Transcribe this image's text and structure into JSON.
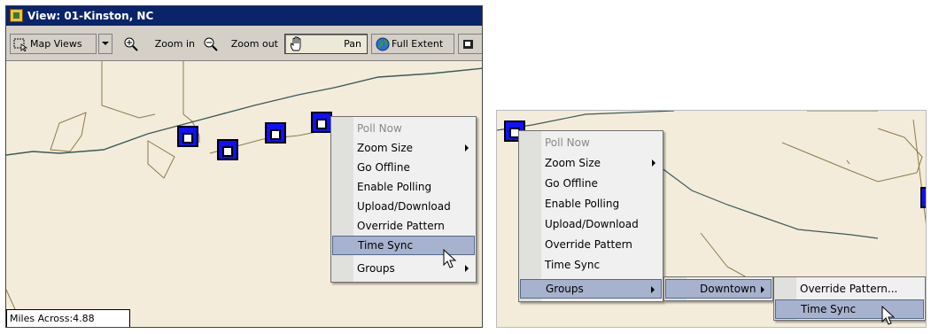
{
  "left_window": {
    "title": "View: 01-Kinston, NC",
    "toolbar": {
      "map_views": "Map Views",
      "zoom_in": "Zoom in",
      "zoom_out": "Zoom out",
      "pan": "Pan",
      "full_extent": "Full Extent"
    },
    "scale_text": "Miles Across:4.88",
    "context_menu": [
      {
        "label": "Poll Now"
      },
      {
        "label": "Zoom Size"
      },
      {
        "label": "Go Offline"
      },
      {
        "label": "Enable Polling"
      },
      {
        "label": "Upload/Download"
      },
      {
        "label": "Override Pattern"
      },
      {
        "label": "Time Sync"
      },
      {
        "label": "Groups"
      }
    ]
  },
  "right_panel": {
    "context_menu": [
      {
        "label": "Poll Now"
      },
      {
        "label": "Zoom Size"
      },
      {
        "label": "Go Offline"
      },
      {
        "label": "Enable Polling"
      },
      {
        "label": "Upload/Download"
      },
      {
        "label": "Override Pattern"
      },
      {
        "label": "Time Sync"
      },
      {
        "label": "Groups"
      }
    ],
    "groups_submenu": [
      {
        "label": "Downtown"
      }
    ],
    "downtown_submenu": [
      {
        "label": "Override Pattern..."
      },
      {
        "label": "Time Sync"
      }
    ]
  },
  "colors": {
    "titlebar": "#0a246a",
    "menu_highlight": "#a7b2cf",
    "map_background": "#f4ecda",
    "device_icon": "#1010ff"
  },
  "icons": [
    "map-views-icon",
    "zoom-in-icon",
    "zoom-out-icon",
    "pan-hand-icon",
    "globe-icon",
    "signal-device-icon",
    "arrow-cursor-icon"
  ]
}
